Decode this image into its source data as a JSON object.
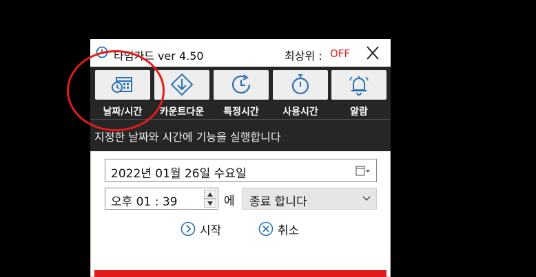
{
  "titlebar": {
    "title": "타임가드 ver 4.50",
    "ontop_label": "최상위 :",
    "ontop_value": "OFF"
  },
  "toolbar": {
    "items": [
      {
        "label": "날짜/시간",
        "icon": "calendar-clock-icon"
      },
      {
        "label": "카운트다운",
        "icon": "download-arrow-icon"
      },
      {
        "label": "특정시간",
        "icon": "clock-refresh-icon"
      },
      {
        "label": "사용시간",
        "icon": "stopwatch-icon"
      },
      {
        "label": "알람",
        "icon": "bell-icon"
      }
    ]
  },
  "description": "지정한 날짜와 시간에 기능을 실행합니다",
  "date_picker": {
    "value": "2022년  01월  26일  수요일"
  },
  "time_picker": {
    "value": "오후  01 : 39"
  },
  "connector": "에",
  "action_select": {
    "value": "종료 합니다"
  },
  "buttons": {
    "start": "시작",
    "cancel": "취소"
  },
  "colors": {
    "toolbar_bg": "#262626",
    "accent_red": "#e21c1c",
    "off_text": "#e02020",
    "icon_blue": "#2a6fb5"
  }
}
